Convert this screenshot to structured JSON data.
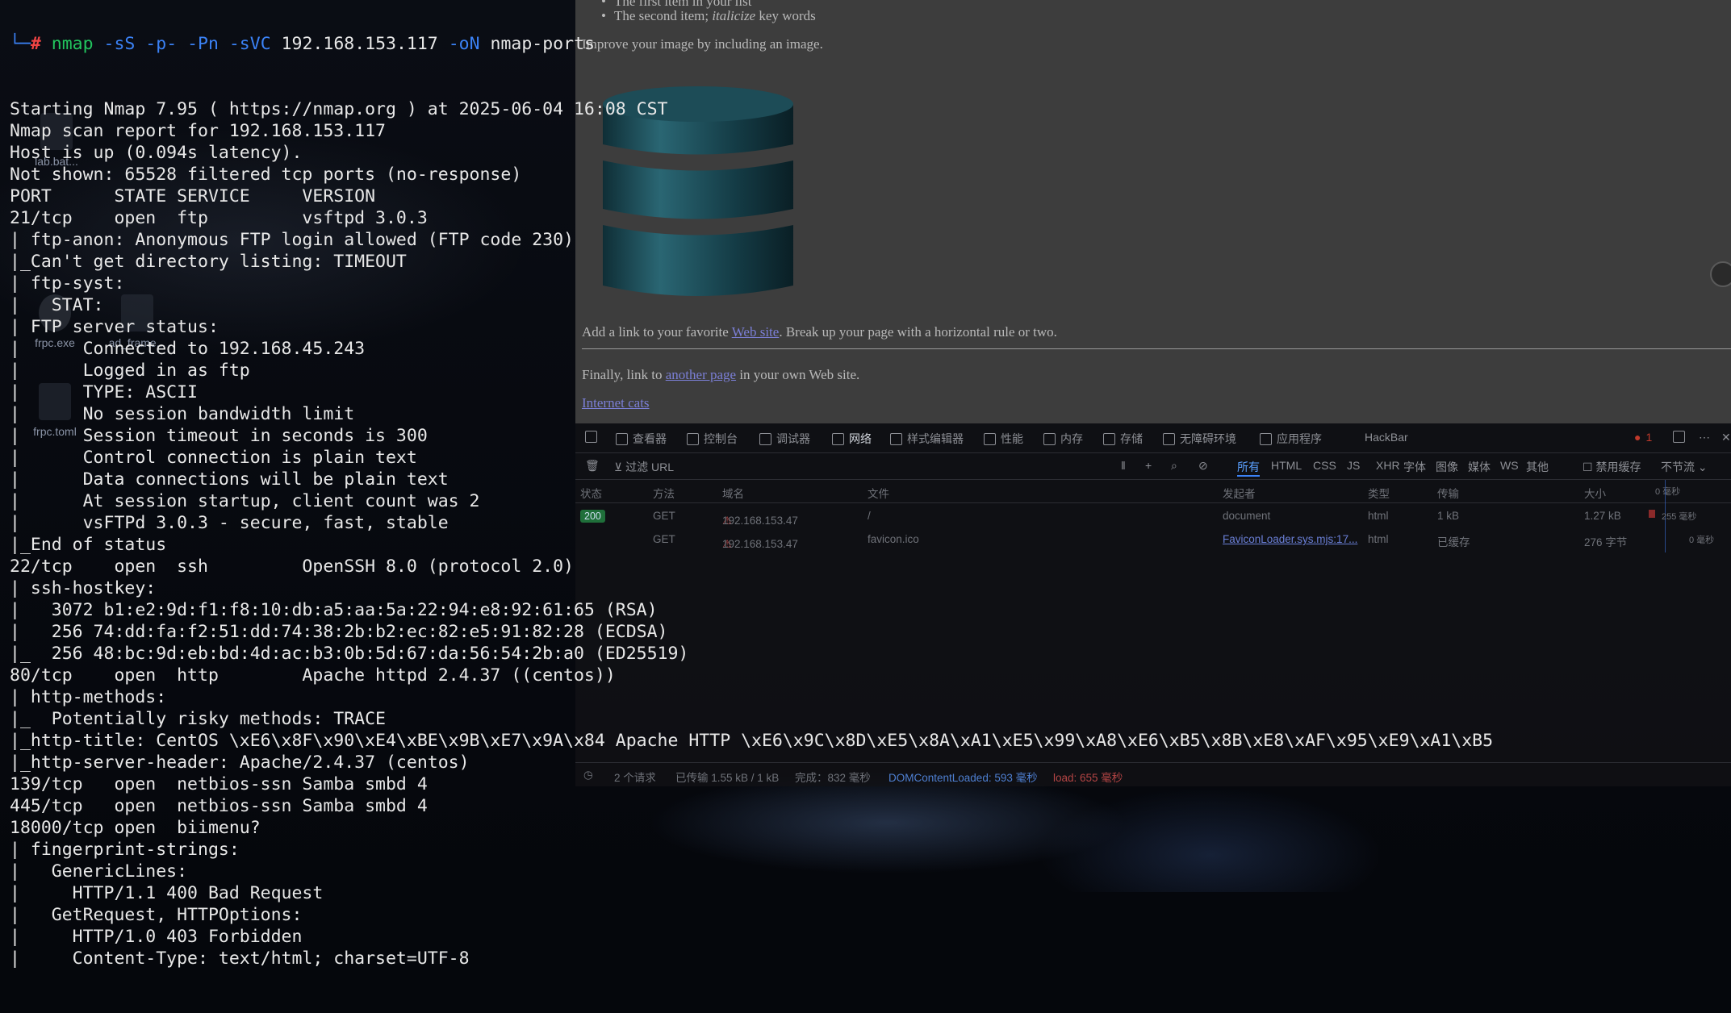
{
  "desktop": {
    "icons": [
      "lab.bat...",
      "frpc.exe",
      "ad_frame...",
      "frpc.toml"
    ]
  },
  "terminal": {
    "prompt_corner": "└─",
    "prompt_hash": "#",
    "command": {
      "program": "nmap",
      "flags": "-sS -p- -Pn -sVC",
      "target": "192.168.153.117",
      "output_flag": "-oN",
      "output_file": "nmap-ports"
    },
    "lines": [
      "Starting Nmap 7.95 ( https://nmap.org ) at 2025-06-04 16:08 CST",
      "Nmap scan report for 192.168.153.117",
      "Host is up (0.094s latency).",
      "Not shown: 65528 filtered tcp ports (no-response)",
      "PORT      STATE SERVICE     VERSION",
      "21/tcp    open  ftp         vsftpd 3.0.3",
      "| ftp-anon: Anonymous FTP login allowed (FTP code 230)",
      "|_Can't get directory listing: TIMEOUT",
      "| ftp-syst: ",
      "|   STAT: ",
      "| FTP server status:",
      "|      Connected to 192.168.45.243",
      "|      Logged in as ftp",
      "|      TYPE: ASCII",
      "|      No session bandwidth limit",
      "|      Session timeout in seconds is 300",
      "|      Control connection is plain text",
      "|      Data connections will be plain text",
      "|      At session startup, client count was 2",
      "|      vsFTPd 3.0.3 - secure, fast, stable",
      "|_End of status",
      "22/tcp    open  ssh         OpenSSH 8.0 (protocol 2.0)",
      "| ssh-hostkey: ",
      "|   3072 b1:e2:9d:f1:f8:10:db:a5:aa:5a:22:94:e8:92:61:65 (RSA)",
      "|   256 74:dd:fa:f2:51:dd:74:38:2b:b2:ec:82:e5:91:82:28 (ECDSA)",
      "|_  256 48:bc:9d:eb:bd:4d:ac:b3:0b:5d:67:da:56:54:2b:a0 (ED25519)",
      "80/tcp    open  http        Apache httpd 2.4.37 ((centos))",
      "| http-methods: ",
      "|_  Potentially risky methods: TRACE",
      "|_http-title: CentOS \\xE6\\x8F\\x90\\xE4\\xBE\\x9B\\xE7\\x9A\\x84 Apache HTTP \\xE6\\x9C\\x8D\\xE5\\x8A\\xA1\\xE5\\x99\\xA8\\xE6\\xB5\\x8B\\xE8\\xAF\\x95\\xE9\\xA1\\xB5",
      "|_http-server-header: Apache/2.4.37 (centos)",
      "139/tcp   open  netbios-ssn Samba smbd 4",
      "445/tcp   open  netbios-ssn Samba smbd 4",
      "18000/tcp open  biimenu?",
      "| fingerprint-strings: ",
      "|   GenericLines: ",
      "|     HTTP/1.1 400 Bad Request",
      "|   GetRequest, HTTPOptions: ",
      "|     HTTP/1.0 403 Forbidden",
      "|     Content-Type: text/html; charset=UTF-8"
    ]
  },
  "webpage": {
    "list_item_1": "The first item in your list",
    "list_item_2_prefix": "The second item; ",
    "list_item_2_italic": "italicize",
    "list_item_2_suffix": " key words",
    "improve_text": "Improve your image by including an image.",
    "para_link_prefix": "Add a link to your favorite ",
    "para_link_text": "Web site",
    "para_link_suffix": ". Break up your page with a horizontal rule or two.",
    "finally_prefix": "Finally, link to ",
    "finally_link": "another page",
    "finally_suffix": " in your own Web site.",
    "cats_link": "Internet cats"
  },
  "devtools": {
    "tabs": [
      "查看器",
      "控制台",
      "调试器",
      "网络",
      "样式编辑器",
      "性能",
      "内存",
      "存储",
      "无障碍环境",
      "应用程序",
      "HackBar"
    ],
    "active_tab": "网络",
    "error_count": "1",
    "filter_placeholder": "过滤 URL",
    "filter_types": [
      "所有",
      "HTML",
      "CSS",
      "JS",
      "XHR",
      "字体",
      "图像",
      "媒体",
      "WS",
      "其他"
    ],
    "disable_cache": "禁用缓存",
    "throttle": "不节流",
    "columns": [
      "状态",
      "方法",
      "域名",
      "文件",
      "发起者",
      "类型",
      "传输",
      "大小"
    ],
    "waterfall_label": "0 毫秒",
    "requests": [
      {
        "status": "200",
        "method": "GET",
        "domain": "192.168.153.47",
        "file": "/",
        "initiator": "document",
        "type": "html",
        "transferred": "1 kB",
        "size": "1.27 kB",
        "timing": "255 毫秒"
      },
      {
        "status": "",
        "method": "GET",
        "domain": "192.168.153.47",
        "file": "favicon.ico",
        "initiator": "FaviconLoader.sys.mjs:17...",
        "type": "html",
        "transferred": "已缓存",
        "size": "276 字节",
        "timing": "0 毫秒"
      }
    ],
    "summary": {
      "requests": "2 个请求",
      "transferred": "已传输 1.55 kB / 1 kB",
      "finish": "完成：832 毫秒",
      "dcl": "DOMContentLoaded: 593 毫秒",
      "load": "load: 655 毫秒"
    }
  }
}
